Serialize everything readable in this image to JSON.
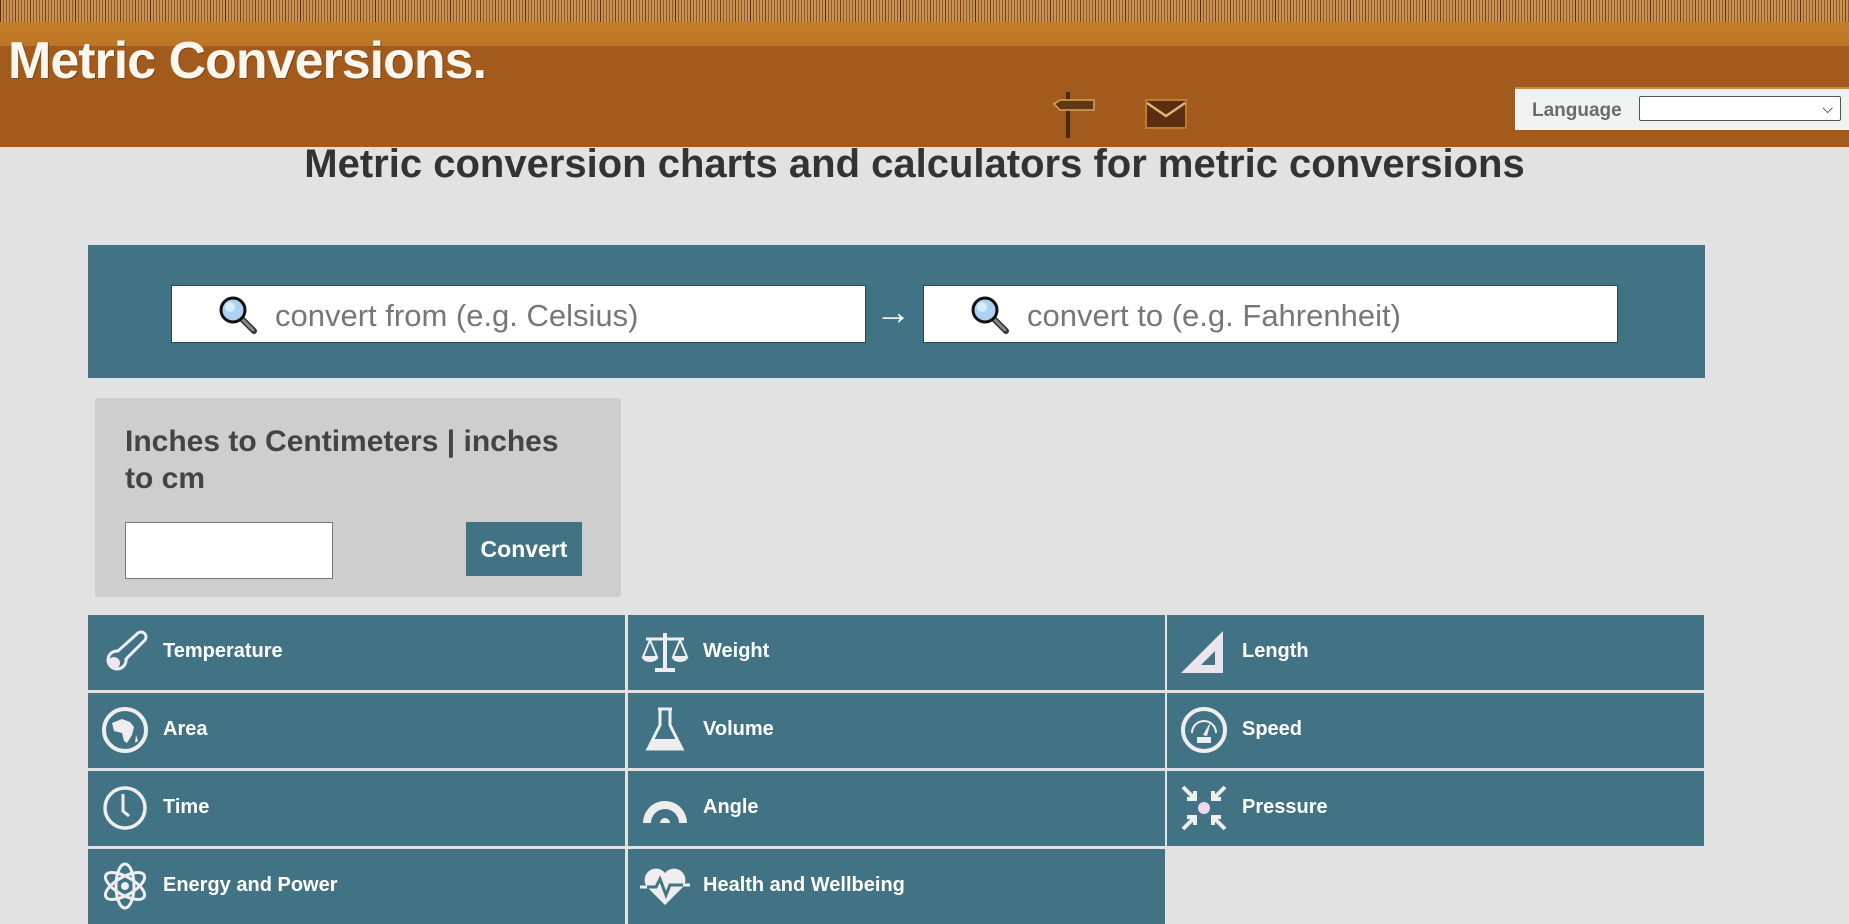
{
  "header": {
    "logo": "Metric Conversions.",
    "icons": [
      "signpost-icon",
      "envelope-icon"
    ],
    "language_label": "Language",
    "language_selected": ""
  },
  "page_title": "Metric conversion charts and calculators for metric conversions",
  "search": {
    "from_placeholder": "convert from (e.g. Celsius)",
    "to_placeholder": "convert to (e.g. Fahrenheit)",
    "arrow": "→"
  },
  "quick_converter": {
    "title": "Inches to Centimeters | inches to cm",
    "input_value": "",
    "button_label": "Convert"
  },
  "categories": [
    {
      "label": "Temperature",
      "icon": "thermometer-icon"
    },
    {
      "label": "Weight",
      "icon": "scales-icon"
    },
    {
      "label": "Length",
      "icon": "set-square-icon"
    },
    {
      "label": "Area",
      "icon": "globe-icon"
    },
    {
      "label": "Volume",
      "icon": "flask-icon"
    },
    {
      "label": "Speed",
      "icon": "speedometer-icon"
    },
    {
      "label": "Time",
      "icon": "clock-icon"
    },
    {
      "label": "Angle",
      "icon": "protractor-icon"
    },
    {
      "label": "Pressure",
      "icon": "compress-arrows-icon"
    },
    {
      "label": "Energy and Power",
      "icon": "atom-icon"
    },
    {
      "label": "Health and Wellbeing",
      "icon": "heartbeat-icon"
    }
  ],
  "colors": {
    "header_brown": "#a35b1d",
    "accent_blue": "#417385",
    "page_bg": "#e2e2e2",
    "card_bg": "#cecece"
  }
}
